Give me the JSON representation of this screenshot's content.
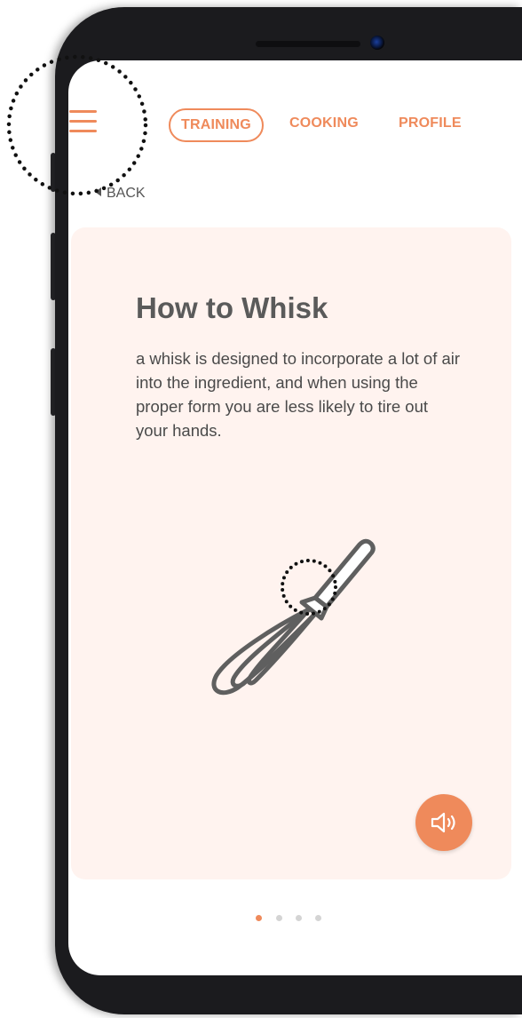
{
  "nav": {
    "tabs": [
      {
        "label": "TRAINING",
        "active": true
      },
      {
        "label": "COOKING",
        "active": false
      },
      {
        "label": "PROFILE",
        "active": false
      }
    ]
  },
  "back_label": "BACK",
  "card": {
    "title": "How to Whisk",
    "body": "a whisk is designed to incorporate a lot of air into the ingredient, and when using the proper form you are less likely to tire out your hands.",
    "illustration": "whisk-icon",
    "audio_icon": "speaker-icon"
  },
  "pagination": {
    "total": 4,
    "active_index": 0
  },
  "colors": {
    "accent": "#ef8a5b",
    "card_bg": "#fff3ef",
    "text": "#4a4a4a",
    "icon": "#5f5f5f"
  }
}
